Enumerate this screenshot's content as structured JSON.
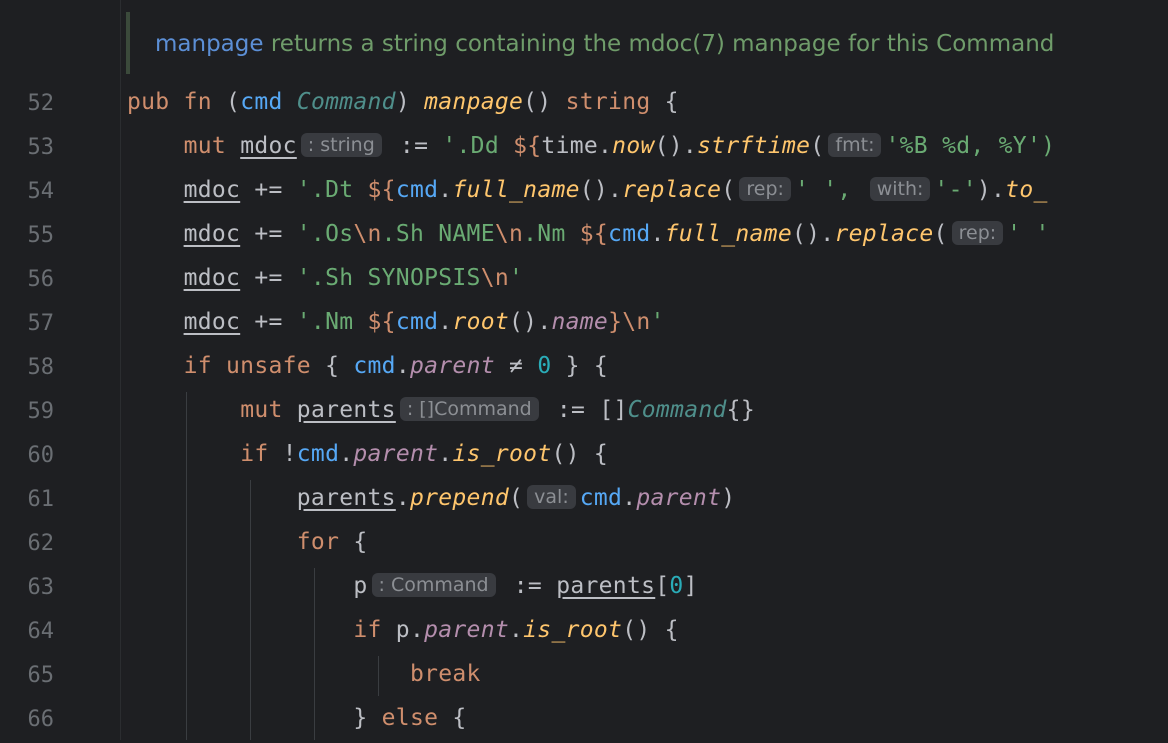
{
  "doc_comment": {
    "ref": "manpage",
    "text": " returns a string containing the mdoc(7) manpage for this Command"
  },
  "lines": [
    {
      "num": "52"
    },
    {
      "num": "53"
    },
    {
      "num": "54"
    },
    {
      "num": "55"
    },
    {
      "num": "56"
    },
    {
      "num": "57"
    },
    {
      "num": "58"
    },
    {
      "num": "59"
    },
    {
      "num": "60"
    },
    {
      "num": "61"
    },
    {
      "num": "62"
    },
    {
      "num": "63"
    },
    {
      "num": "64"
    },
    {
      "num": "65"
    },
    {
      "num": "66"
    }
  ],
  "hints": {
    "string": ": string",
    "fmt": "fmt:",
    "rep": "rep:",
    "with": "with:",
    "command_arr": ": []Command",
    "val": "val:",
    "command": ": Command"
  },
  "colors": {
    "background": "#1e1f22",
    "keyword": "#cf8e6d",
    "function": "#ffc66d",
    "string": "#6aab73",
    "doc_comment": "#6f9c6a"
  }
}
